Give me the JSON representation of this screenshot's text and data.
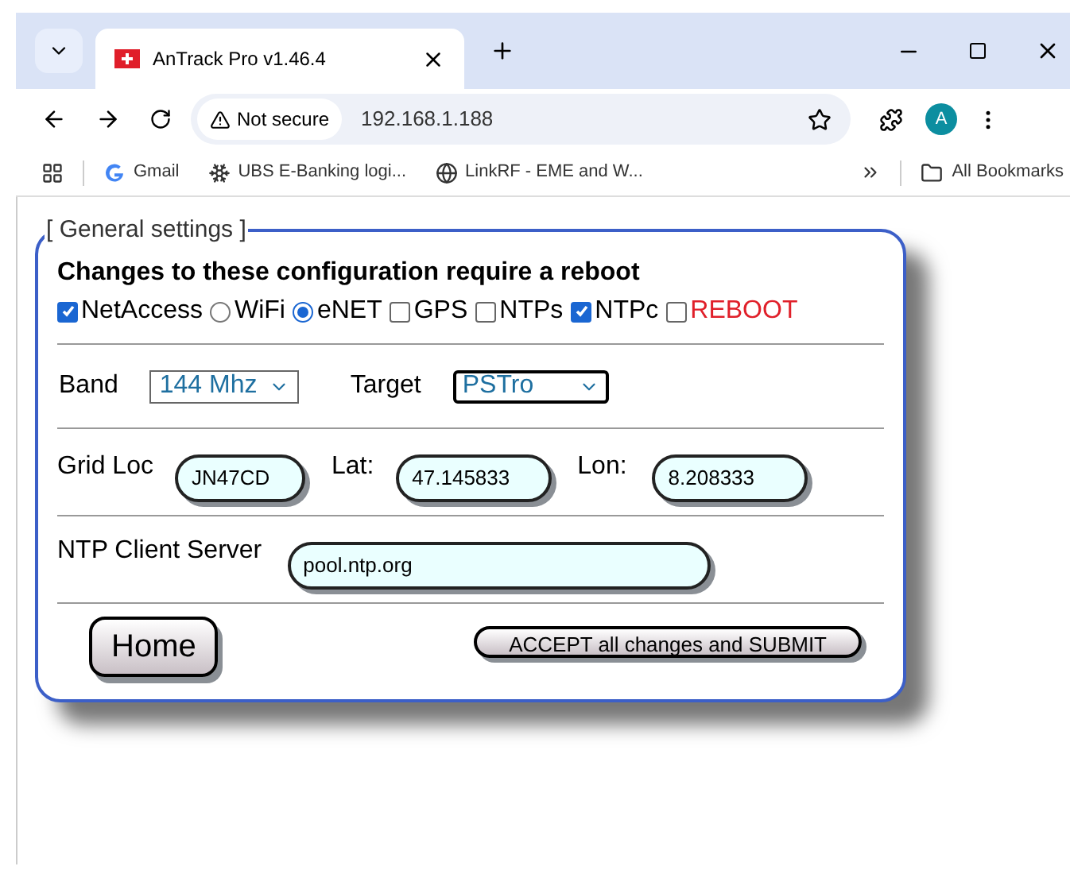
{
  "browser": {
    "tab_title": "AnTrack Pro v1.46.4",
    "security": "Not secure",
    "url": "192.168.1.188",
    "avatar": "A",
    "bookmarks": [
      {
        "label": "Gmail"
      },
      {
        "label": "UBS E-Banking logi..."
      },
      {
        "label": "LinkRF - EME and W..."
      }
    ],
    "all_bookmarks": "All Bookmarks"
  },
  "settings": {
    "legend": "[ General settings ]",
    "heading": "Changes to these configuration require a reboot",
    "options": [
      {
        "kind": "checkbox",
        "label": "NetAccess",
        "checked": true,
        "color": "#000000"
      },
      {
        "kind": "radio",
        "label": "WiFi",
        "checked": false,
        "color": "#000000"
      },
      {
        "kind": "radio",
        "label": "eNET",
        "checked": true,
        "color": "#000000"
      },
      {
        "kind": "checkbox",
        "label": "GPS",
        "checked": false,
        "color": "#000000"
      },
      {
        "kind": "checkbox",
        "label": "NTPs",
        "checked": false,
        "color": "#000000"
      },
      {
        "kind": "checkbox",
        "label": "NTPc",
        "checked": true,
        "color": "#000000"
      },
      {
        "kind": "checkbox",
        "label": "REBOOT",
        "checked": false,
        "color": "#e0202a"
      }
    ],
    "band": {
      "label": "Band",
      "value": "144 Mhz"
    },
    "target": {
      "label": "Target",
      "value": "PSTro"
    },
    "grid": {
      "label": "Grid Loc",
      "value": "JN47CD"
    },
    "lat": {
      "label": "Lat:",
      "value": "47.145833"
    },
    "lon": {
      "label": "Lon:",
      "value": "8.208333"
    },
    "ntp": {
      "label": "NTP Client Server",
      "value": "pool.ntp.org"
    },
    "home": "Home",
    "submit": "ACCEPT all changes and SUBMIT"
  }
}
